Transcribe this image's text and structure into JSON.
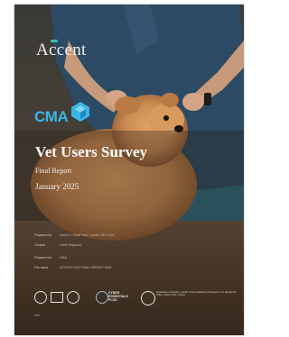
{
  "brand": {
    "accent_logo": "Accent",
    "cma_logo": "CMA"
  },
  "cover": {
    "title": "Vet Users Survey",
    "subtitle": "Final Report",
    "date": "January 2025"
  },
  "meta": [
    {
      "label": "Prepared by",
      "value": "Accent, 2 Bowl Yard, London SE1 9QU"
    },
    {
      "label": "Contact",
      "value": "Chris Heywood"
    },
    {
      "label": "Prepared for",
      "value": "CMA"
    },
    {
      "label": "File name",
      "value": "ACCENT VUS FINAL REPORT 2025"
    }
  ],
  "footer": {
    "cyber_essentials": [
      "CYBER",
      "ESSENTIALS",
      "PLUS"
    ],
    "address": "Registered in England, Cardiff. Accent Marketing & Research Ltd. Registered Office: 2 Bowl Yard, London",
    "page": "1/35"
  },
  "colors": {
    "accent_teal": "#36c0b6",
    "cma_blue": "#3bb6e8",
    "scrub_blue": "#2c4a63",
    "dog_orange": "#c98a52"
  }
}
